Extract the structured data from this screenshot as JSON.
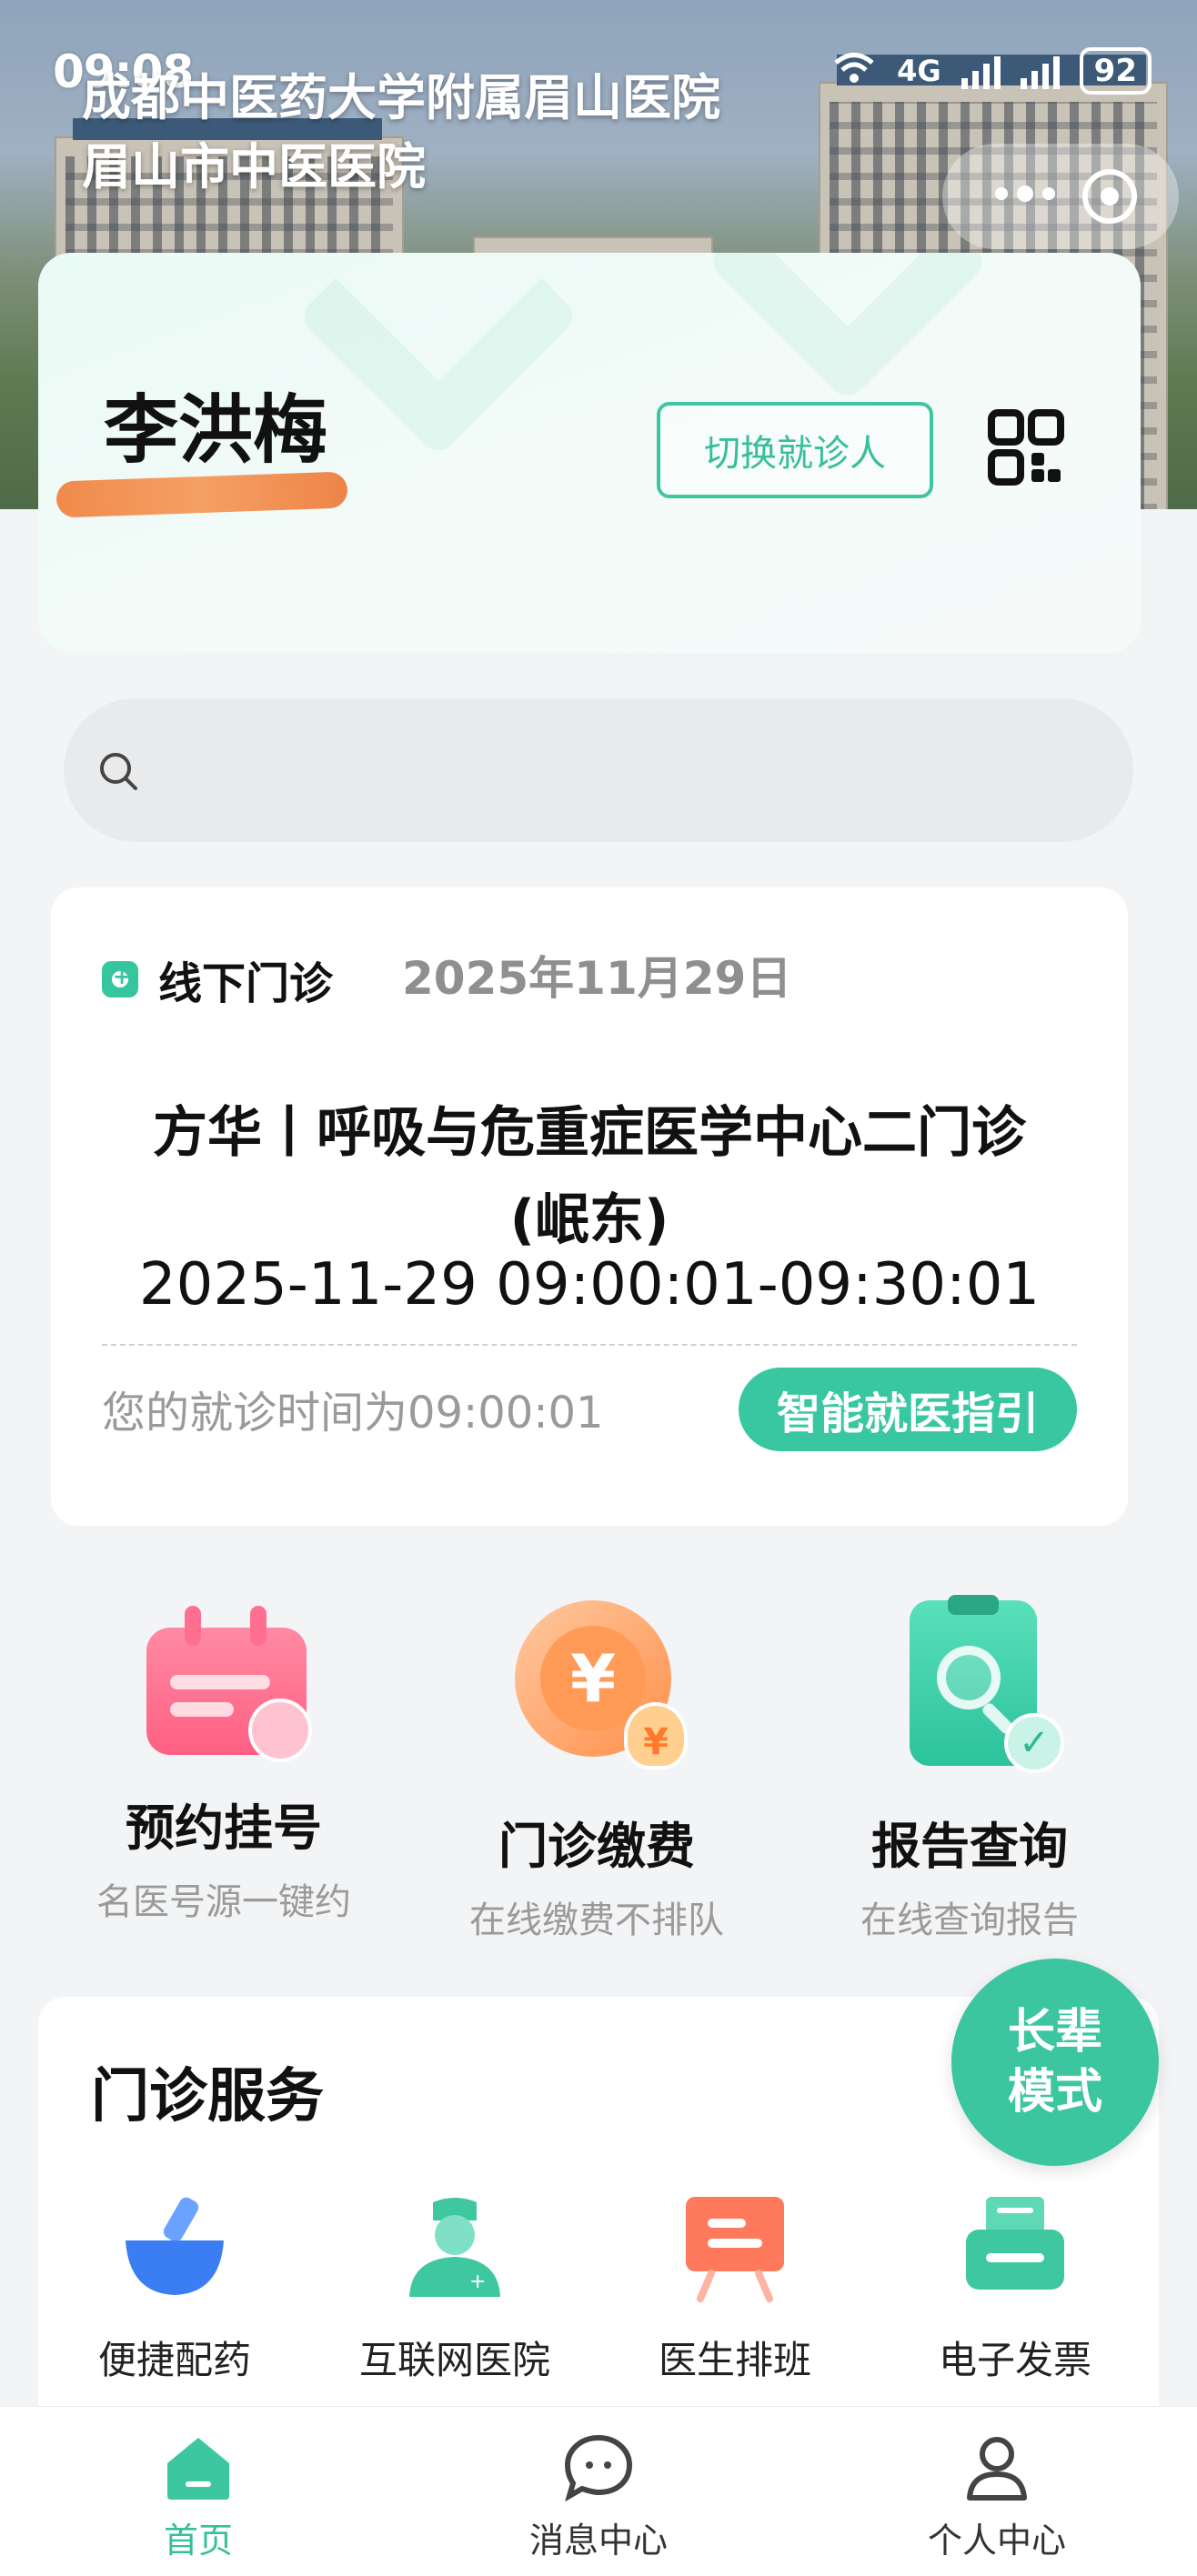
{
  "status_bar": {
    "time": "09:08",
    "network": "4G",
    "battery": "92"
  },
  "header": {
    "title_line1": "成都中医药大学附属眉山医院",
    "title_line2": "眉山市中医医院"
  },
  "patient": {
    "name": "李洪梅",
    "switch_label": "切换就诊人"
  },
  "search": {
    "placeholder": ""
  },
  "appointment": {
    "type": "线下门诊",
    "date": "2025年11月29日",
    "dept_line1": "方华丨呼吸与危重症医学中心二门诊",
    "dept_line2": "(岷东)",
    "time_range": "2025-11-29 09:00:01-09:30:01",
    "note": "您的就诊时间为09:00:01",
    "guide_label": "智能就医指引"
  },
  "main_services": [
    {
      "title": "预约挂号",
      "subtitle": "名医号源一键约",
      "icon": "calendar-icon"
    },
    {
      "title": "门诊缴费",
      "subtitle": "在线缴费不排队",
      "icon": "yuan-coin-icon"
    },
    {
      "title": "报告查询",
      "subtitle": "在线查询报告",
      "icon": "report-search-icon"
    }
  ],
  "outpatient": {
    "title": "门诊服务",
    "items": [
      {
        "label": "便捷配药",
        "icon": "mortar-icon"
      },
      {
        "label": "互联网医院",
        "icon": "nurse-icon"
      },
      {
        "label": "医生排班",
        "icon": "schedule-board-icon"
      },
      {
        "label": "电子发票",
        "icon": "printer-icon"
      }
    ]
  },
  "elder_mode": {
    "line1": "长辈",
    "line2": "模式"
  },
  "tabbar": [
    {
      "label": "首页",
      "icon": "home-icon",
      "active": true
    },
    {
      "label": "消息中心",
      "icon": "message-icon",
      "active": false
    },
    {
      "label": "个人中心",
      "icon": "user-icon",
      "active": false
    }
  ],
  "colors": {
    "accent": "#36bf9a",
    "pink": "#ff6f8f",
    "orange": "#ff9a57"
  }
}
